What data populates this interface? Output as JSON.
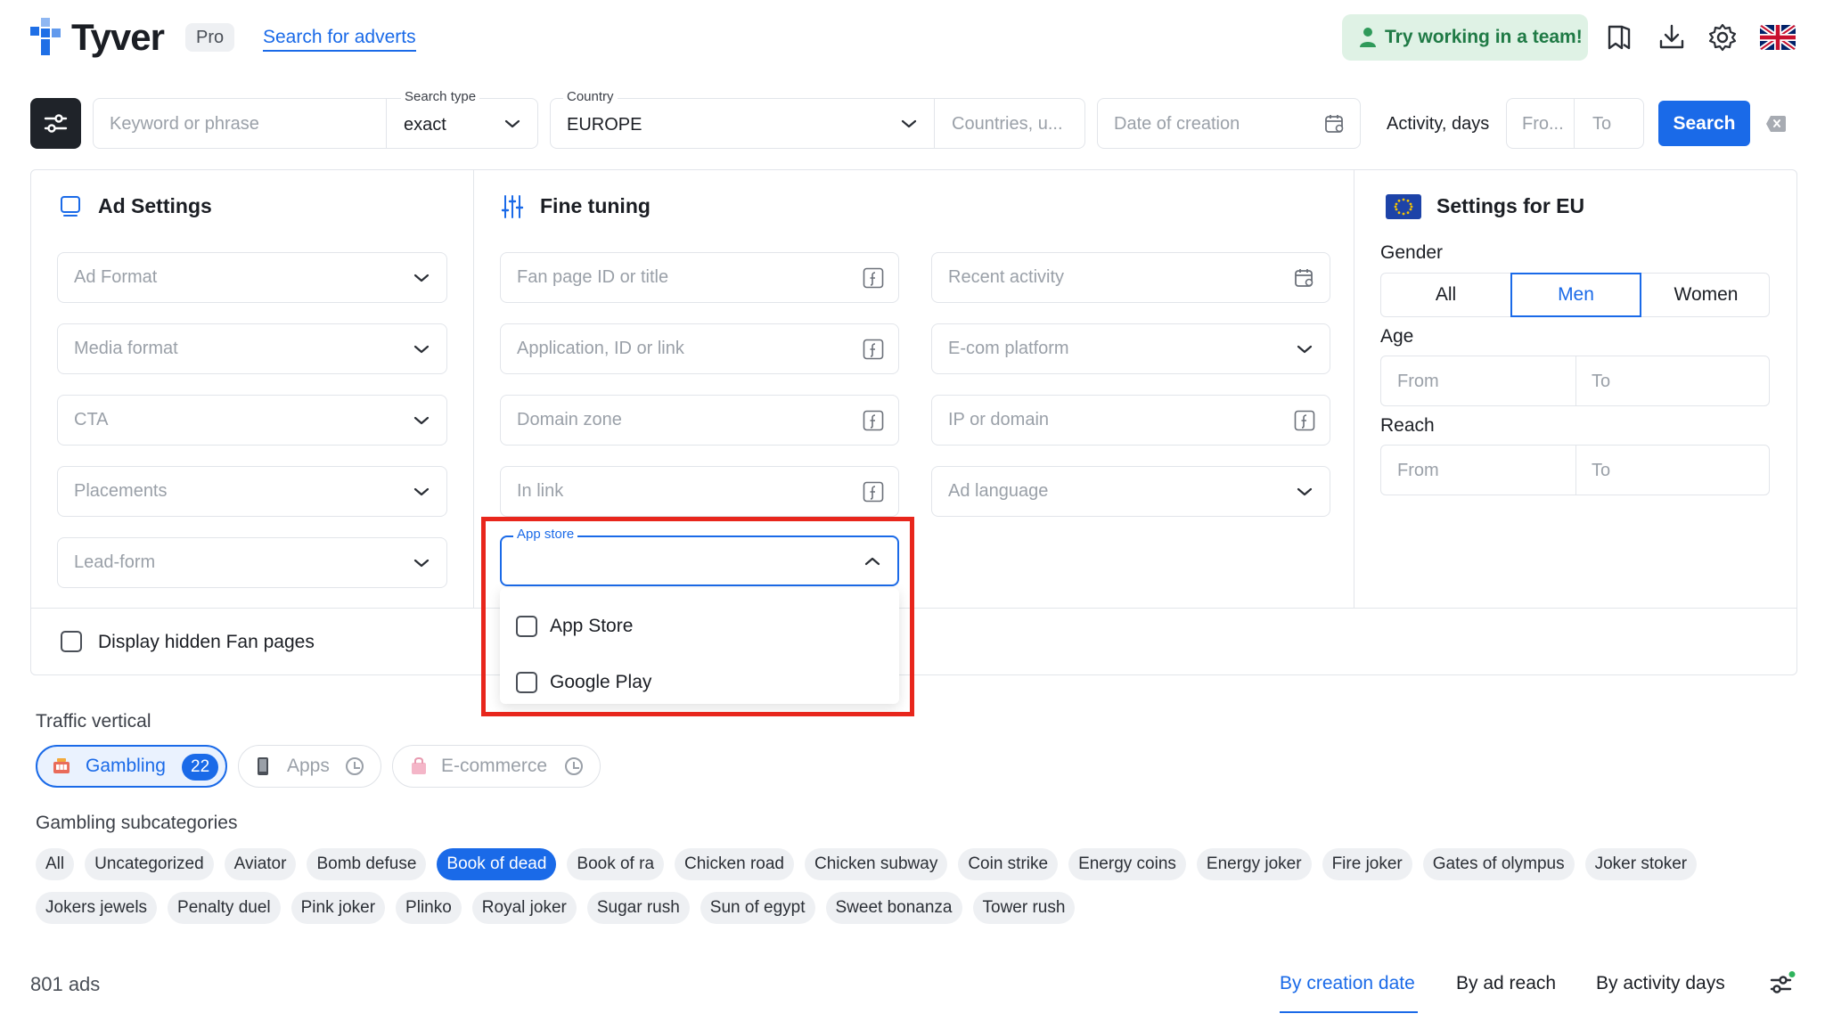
{
  "header": {
    "brand": "Tyver",
    "plan_badge": "Pro",
    "search_adverts_link": "Search for adverts",
    "team_button": "Try working in a team!",
    "icons": [
      "bookmark-icon",
      "download-icon",
      "gear-icon",
      "uk-flag-icon"
    ]
  },
  "search_bar": {
    "keyword_placeholder": "Keyword or phrase",
    "search_type_label": "Search type",
    "search_type_value": "exact",
    "country_label": "Country",
    "country_value": "EUROPE",
    "countries_placeholder": "Countries, u...",
    "date_placeholder": "Date of creation",
    "activity_label": "Activity, days",
    "activity_from_placeholder": "Fro...",
    "activity_to_placeholder": "To",
    "search_button": "Search"
  },
  "ad_settings": {
    "title": "Ad Settings",
    "fields": [
      "Ad Format",
      "Media format",
      "CTA",
      "Placements",
      "Lead-form"
    ]
  },
  "fine_tuning": {
    "title": "Fine tuning",
    "left_fields": [
      "Fan page ID or title",
      "Application, ID or link",
      "Domain zone",
      "In link"
    ],
    "right_fields": [
      "Recent activity",
      "E-com platform",
      "IP or domain",
      "Ad language"
    ],
    "app_store": {
      "label": "App store",
      "options": [
        "App Store",
        "Google Play"
      ]
    }
  },
  "eu_settings": {
    "title": "Settings for EU",
    "gender_label": "Gender",
    "gender_options": [
      "All",
      "Men",
      "Women"
    ],
    "gender_selected": "Men",
    "age_label": "Age",
    "age_from": "From",
    "age_to": "To",
    "reach_label": "Reach",
    "reach_from": "From",
    "reach_to": "To"
  },
  "hidden_fan_pages_label": "Display hidden Fan pages",
  "traffic_vertical": {
    "title": "Traffic vertical",
    "items": [
      {
        "label": "Gambling",
        "count": "22",
        "selected": true
      },
      {
        "label": "Apps",
        "selected": false
      },
      {
        "label": "E-commerce",
        "selected": false
      }
    ]
  },
  "gambling_subcategories": {
    "title": "Gambling subcategories",
    "selected": "Book of dead",
    "items": [
      "All",
      "Uncategorized",
      "Aviator",
      "Bomb defuse",
      "Book of dead",
      "Book of ra",
      "Chicken road",
      "Chicken subway",
      "Coin strike",
      "Energy coins",
      "Energy joker",
      "Fire joker",
      "Gates of olympus",
      "Joker stoker",
      "Jokers jewels",
      "Penalty duel",
      "Pink joker",
      "Plinko",
      "Royal joker",
      "Sugar rush",
      "Sun of egypt",
      "Sweet bonanza",
      "Tower rush"
    ]
  },
  "results": {
    "count": "801 ads",
    "sort_options": [
      "By creation date",
      "By ad reach",
      "By activity days"
    ],
    "sort_selected": "By creation date"
  },
  "colors": {
    "accent": "#1a6ae8",
    "highlight_box": "#e8261c",
    "team_green": "#1f7a45"
  }
}
